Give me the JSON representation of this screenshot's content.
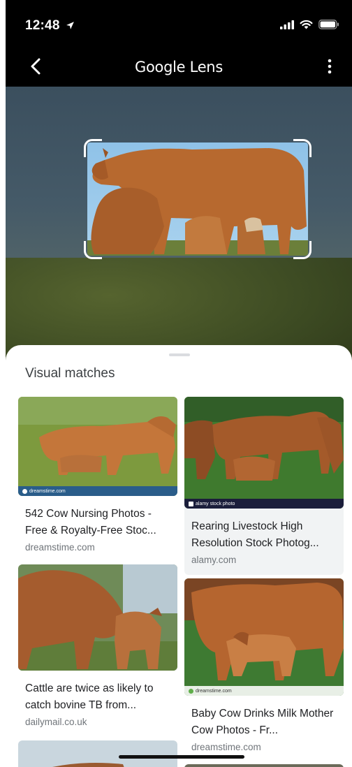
{
  "status_bar": {
    "time": "12:48"
  },
  "app_bar": {
    "title": "Google Lens"
  },
  "sheet": {
    "title": "Visual matches"
  },
  "results": [
    {
      "title": "542 Cow Nursing Photos - Free & Royalty-Free Stoc...",
      "domain": "dreamstime.com",
      "source_badge": "dreamstime.com"
    },
    {
      "title": "Rearing Livestock High Resolution Stock Photog...",
      "domain": "alamy.com",
      "source_badge": "alamy stock photo"
    },
    {
      "title": "Cattle are twice as likely to catch bovine TB from...",
      "domain": "dailymail.co.uk"
    },
    {
      "title": "Baby Cow Drinks Milk Mother Cow Photos - Fr...",
      "domain": "dreamstime.com",
      "source_badge": "dreamstime.com"
    }
  ],
  "colors": {
    "accent_blue": "#1a73e8",
    "text_primary": "#202124",
    "text_secondary": "#70757a"
  }
}
